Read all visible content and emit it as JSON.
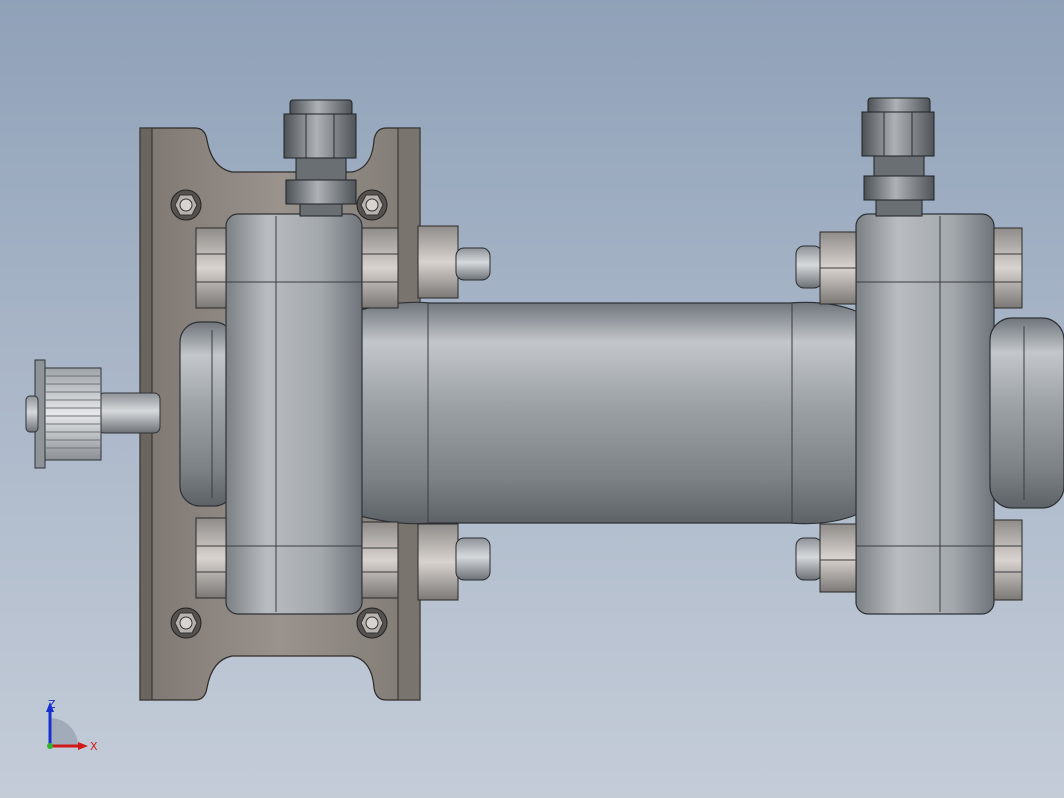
{
  "view": {
    "background_top": "#8fa1b8",
    "background_bottom": "#c4ccd8",
    "part_color": "#a9adb1",
    "plate_color": "#8e8782"
  },
  "triad": {
    "z_label": "Z",
    "x_label": "X",
    "z_color": "#1a2fd0",
    "x_color": "#d01a1a"
  }
}
